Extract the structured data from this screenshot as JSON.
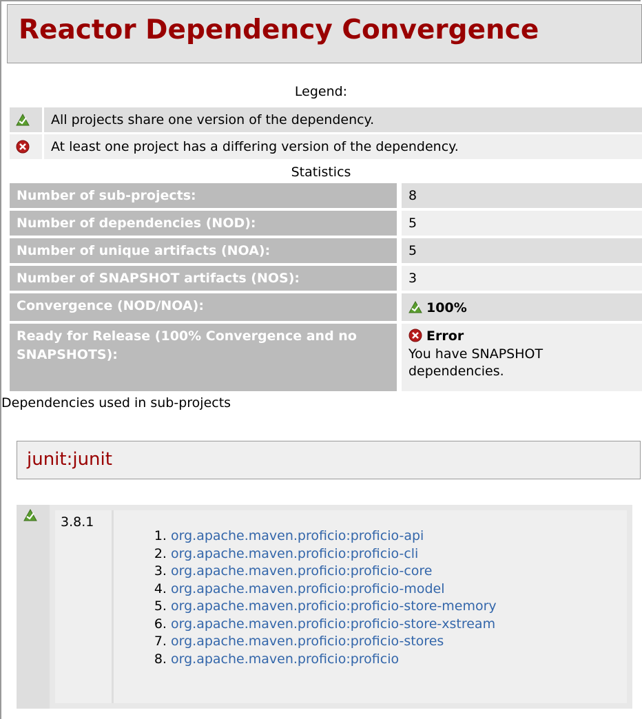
{
  "page": {
    "title": "Reactor Dependency Convergence"
  },
  "legend": {
    "title": "Legend:",
    "items": [
      {
        "icon": "success-icon",
        "text": "All projects share one version of the dependency."
      },
      {
        "icon": "error-icon",
        "text": "At least one project has a differing version of the dependency."
      }
    ]
  },
  "statistics": {
    "title": "Statistics",
    "rows": [
      {
        "label": "Number of sub-projects:",
        "value": "8"
      },
      {
        "label": "Number of dependencies (NOD):",
        "value": "5"
      },
      {
        "label": "Number of unique artifacts (NOA):",
        "value": "5"
      },
      {
        "label": "Number of SNAPSHOT artifacts (NOS):",
        "value": "3"
      },
      {
        "label": "Convergence (NOD/NOA):",
        "value": "100%",
        "icon": "success-icon"
      },
      {
        "label": "Ready for Release (100% Convergence and no SNAPSHOTS):",
        "value": "Error",
        "icon": "error-icon",
        "note": "You have SNAPSHOT dependencies."
      }
    ]
  },
  "dependencies": {
    "title": "Dependencies used in sub-projects",
    "groups": [
      {
        "name": "junit:junit",
        "icon": "success-icon",
        "version": "3.8.1",
        "projects": [
          "org.apache.maven.proficio:proficio-api",
          "org.apache.maven.proficio:proficio-cli",
          "org.apache.maven.proficio:proficio-core",
          "org.apache.maven.proficio:proficio-model",
          "org.apache.maven.proficio:proficio-store-memory",
          "org.apache.maven.proficio:proficio-store-xstream",
          "org.apache.maven.proficio:proficio-stores",
          "org.apache.maven.proficio:proficio"
        ]
      }
    ]
  },
  "colors": {
    "heading": "#990000",
    "link": "#3366aa",
    "label_bg": "#bbbbbb",
    "row_dark": "#dedede",
    "row_light": "#efefef"
  }
}
